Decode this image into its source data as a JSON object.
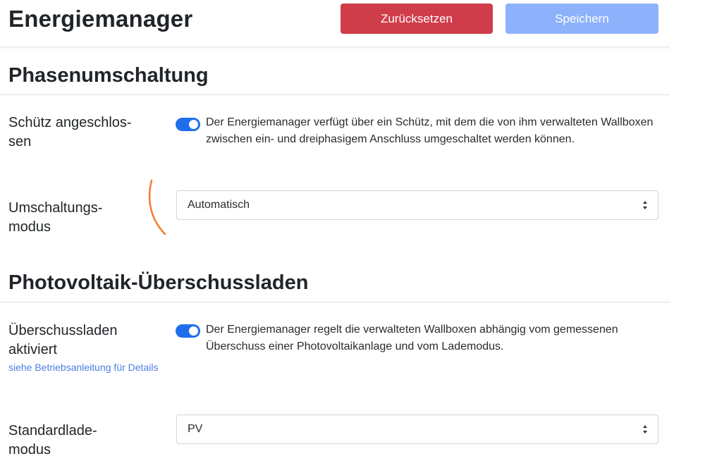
{
  "header": {
    "title": "Energiemanager",
    "reset_label": "Zurücksetzen",
    "save_label": "Speichern"
  },
  "sections": {
    "phase": {
      "title": "Phasenumschaltung",
      "contactor": {
        "label": "Schütz angeschlos-sen",
        "enabled": true,
        "description": "Der Energiemanager verfügt über ein Schütz, mit dem die von ihm verwalteten Wallboxen zwischen ein- und dreiphasigem Anschluss umgeschaltet werden können."
      },
      "mode": {
        "label": "Umschaltungs-modus",
        "value": "Automatisch"
      }
    },
    "pv": {
      "title": "Photovoltaik-Überschussladen",
      "excess": {
        "label": "Überschussladen aktiviert",
        "help": "siehe Betriebsanleitung für Details",
        "enabled": true,
        "description": "Der Energiemanager regelt die verwalteten Wallboxen abhängig vom gemessenen Überschuss einer Photovoltaikanlage und vom Lademodus."
      },
      "default_mode": {
        "label": "Standardlade-modus",
        "value": "PV"
      }
    }
  },
  "colors": {
    "reset": "#d03d4a",
    "save": "#8db2fb",
    "toggle": "#1f6fec",
    "help_link": "#4a7fe0",
    "annotation": "#f07d2e"
  }
}
